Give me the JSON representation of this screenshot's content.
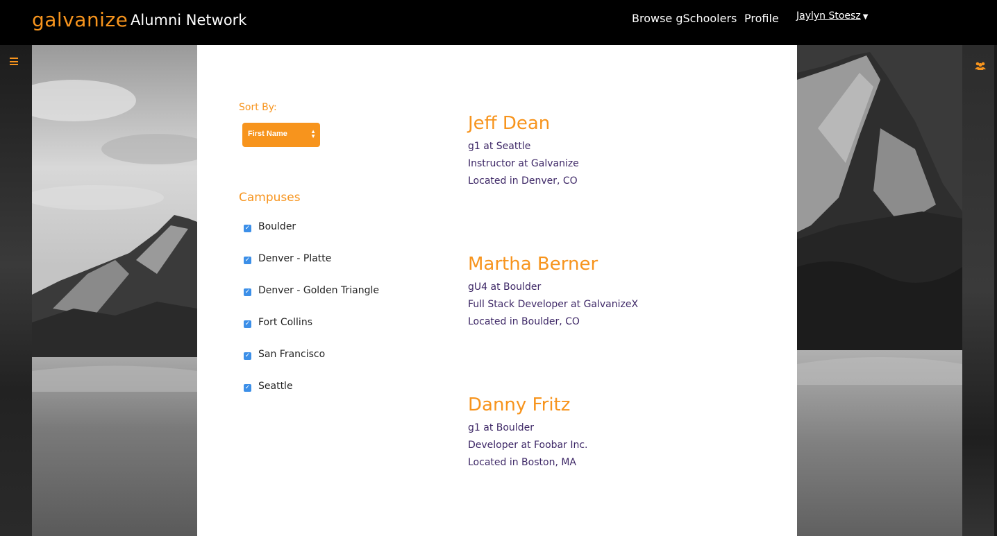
{
  "navbar": {
    "logo_text": "galvanize",
    "title": "Alumni Network",
    "links": {
      "browse": "Browse gSchoolers",
      "profile": "Profile"
    },
    "user_name": "Jaylyn Stoesz"
  },
  "sidebar": {
    "sort_label": "Sort By:",
    "sort_value": "First Name",
    "campuses_title": "Campuses",
    "campuses": [
      {
        "label": "Boulder",
        "checked": true
      },
      {
        "label": "Denver - Platte",
        "checked": true
      },
      {
        "label": "Denver - Golden Triangle",
        "checked": true
      },
      {
        "label": "Fort Collins",
        "checked": true
      },
      {
        "label": "San Francisco",
        "checked": true
      },
      {
        "label": "Seattle",
        "checked": true
      }
    ]
  },
  "alumni": [
    {
      "name": "Jeff Dean",
      "cohort": "g1 at Seattle",
      "job": "Instructor at Galvanize",
      "location": "Located in Denver, CO"
    },
    {
      "name": "Martha Berner",
      "cohort": "gU4 at Boulder",
      "job": "Full Stack Developer at GalvanizeX",
      "location": "Located in Boulder, CO"
    },
    {
      "name": "Danny Fritz",
      "cohort": "g1 at Boulder",
      "job": "Developer at Foobar Inc.",
      "location": "Located in Boston, MA"
    }
  ],
  "colors": {
    "accent": "#f7941d",
    "text_purple": "#3d2766",
    "checkbox_blue": "#3c8fe8"
  },
  "icons": {
    "menu": "hamburger-icon",
    "group": "users-icon",
    "dropdown": "caret-down-icon"
  }
}
